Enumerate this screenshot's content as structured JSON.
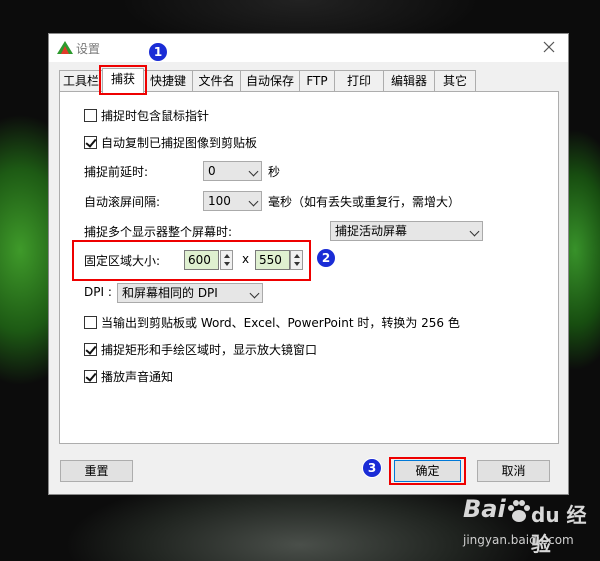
{
  "window": {
    "title": "设置"
  },
  "tabs": [
    "工具栏",
    "捕获",
    "快捷键",
    "文件名",
    "自动保存",
    "FTP",
    "打印",
    "编辑器",
    "其它"
  ],
  "active_tab": "捕获",
  "options": {
    "include_cursor": {
      "label": "捕捉时包含鼠标指针",
      "checked": false
    },
    "auto_copy": {
      "label": "自动复制已捕捉图像到剪贴板",
      "checked": true
    },
    "delay": {
      "label": "捕捉前延时:",
      "value": "0",
      "unit": "秒"
    },
    "scroll": {
      "label": "自动滚屏间隔:",
      "value": "100",
      "unit": "毫秒（如有丢失或重复行，需增大）"
    },
    "multi_monitor": {
      "label": "捕捉多个显示器整个屏幕时:",
      "value": "捕捉活动屏幕"
    },
    "fixed_region": {
      "label": "固定区域大小:",
      "width": "600",
      "x_sep": "x",
      "height": "550"
    },
    "dpi": {
      "label": "DPI :",
      "value": "和屏幕相同的 DPI"
    },
    "convert_256": {
      "label": "当输出到剪贴板或 Word、Excel、PowerPoint 时，转换为 256 色",
      "checked": false
    },
    "magnifier": {
      "label": "捕捉矩形和手绘区域时，显示放大镜窗口",
      "checked": true
    },
    "sound": {
      "label": "播放声音通知",
      "checked": true
    }
  },
  "buttons": {
    "reset": "重置",
    "ok": "确定",
    "cancel": "取消"
  },
  "badges": [
    "1",
    "2",
    "3"
  ],
  "watermark": {
    "brand": "Bai",
    "brand2": "du",
    "cn": "经验",
    "url": "jingyan.baidu.com"
  },
  "colors": {
    "highlight": "#e00000",
    "badge": "#1a2cd6",
    "spin_field": "#dff0d0"
  }
}
